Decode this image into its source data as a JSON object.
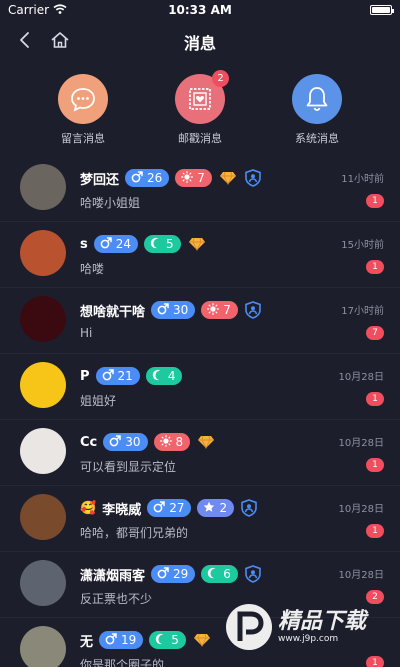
{
  "status_bar": {
    "carrier": "Carrier",
    "time": "10:33 AM"
  },
  "nav": {
    "title": "消息"
  },
  "categories": [
    {
      "label": "留言消息",
      "icon": "chat-bubble-icon",
      "color": "#f0a07a",
      "badge": ""
    },
    {
      "label": "邮戳消息",
      "icon": "stamp-icon",
      "color": "#e8707a",
      "badge": "2"
    },
    {
      "label": "系统消息",
      "icon": "bell-icon",
      "color": "#5a93e8",
      "badge": ""
    }
  ],
  "messages": [
    {
      "name": "梦回还",
      "male_age": "26",
      "second_kind": "sun",
      "second_val": "7",
      "has_gem": true,
      "has_shield": true,
      "preview": "哈喽小姐姐",
      "time": "11小时前",
      "unread": "1",
      "avatar": "#6b6560"
    },
    {
      "name": "s",
      "male_age": "24",
      "second_kind": "moon",
      "second_val": "5",
      "has_gem": true,
      "has_shield": false,
      "preview": "哈喽",
      "time": "15小时前",
      "unread": "1",
      "avatar": "#b8522f"
    },
    {
      "name": "想啥就干啥",
      "male_age": "30",
      "second_kind": "sun",
      "second_val": "7",
      "has_gem": false,
      "has_shield": true,
      "preview": "Hi",
      "time": "17小时前",
      "unread": "7",
      "avatar": "#3a0a10"
    },
    {
      "name": "P",
      "male_age": "21",
      "second_kind": "moon",
      "second_val": "4",
      "has_gem": false,
      "has_shield": false,
      "preview": "姐姐好",
      "time": "10月28日",
      "unread": "1",
      "avatar": "#f7c518"
    },
    {
      "name": "Cc",
      "male_age": "30",
      "second_kind": "sun",
      "second_val": "8",
      "has_gem": true,
      "has_shield": false,
      "preview": "可以看到显示定位",
      "time": "10月28日",
      "unread": "1",
      "avatar": "#e9e6e4"
    },
    {
      "name": "李晓威",
      "name_emoji": "🥰",
      "male_age": "27",
      "second_kind": "star",
      "second_val": "2",
      "has_gem": false,
      "has_shield": true,
      "preview": "哈哈，都哥们兄弟的",
      "time": "10月28日",
      "unread": "1",
      "avatar": "#7a4a2c"
    },
    {
      "name": "潇潇烟雨客",
      "male_age": "29",
      "second_kind": "moon",
      "second_val": "6",
      "has_gem": false,
      "has_shield": true,
      "preview": "反正票也不少",
      "time": "10月28日",
      "unread": "2",
      "avatar": "#5d6470"
    },
    {
      "name": "无",
      "male_age": "19",
      "second_kind": "moon",
      "second_val": "5",
      "has_gem": true,
      "has_shield": false,
      "preview": "你是那个圈子的",
      "time": "",
      "unread": "1",
      "avatar": "#8a8878"
    }
  ],
  "watermark": {
    "brand": "精品下载",
    "url": "www.j9p.com"
  },
  "colors": {
    "background": "#1d1e2c",
    "badge": "#f04e5e",
    "male": "#4b8df5",
    "sun": "#f0646c",
    "moon": "#1ec9a0",
    "star": "#6f8af0"
  }
}
